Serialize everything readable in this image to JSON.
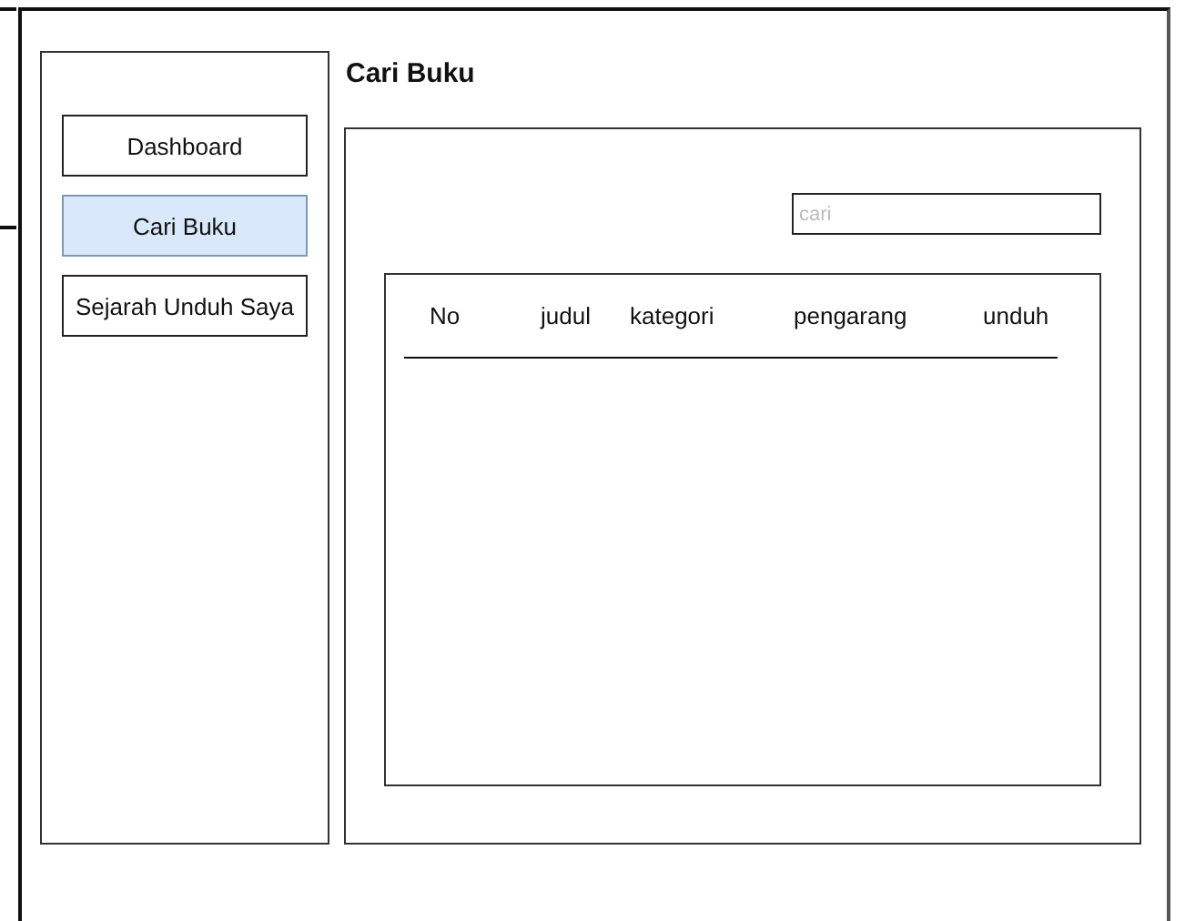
{
  "sidebar": {
    "items": [
      {
        "label": "Dashboard",
        "selected": false
      },
      {
        "label": "Cari Buku",
        "selected": true
      },
      {
        "label": "Sejarah Unduh Saya",
        "selected": false
      }
    ]
  },
  "main": {
    "title": "Cari Buku",
    "search": {
      "placeholder": "cari"
    },
    "table": {
      "columns": [
        "No",
        "judul",
        "kategori",
        "pengarang",
        "unduh"
      ]
    }
  }
}
